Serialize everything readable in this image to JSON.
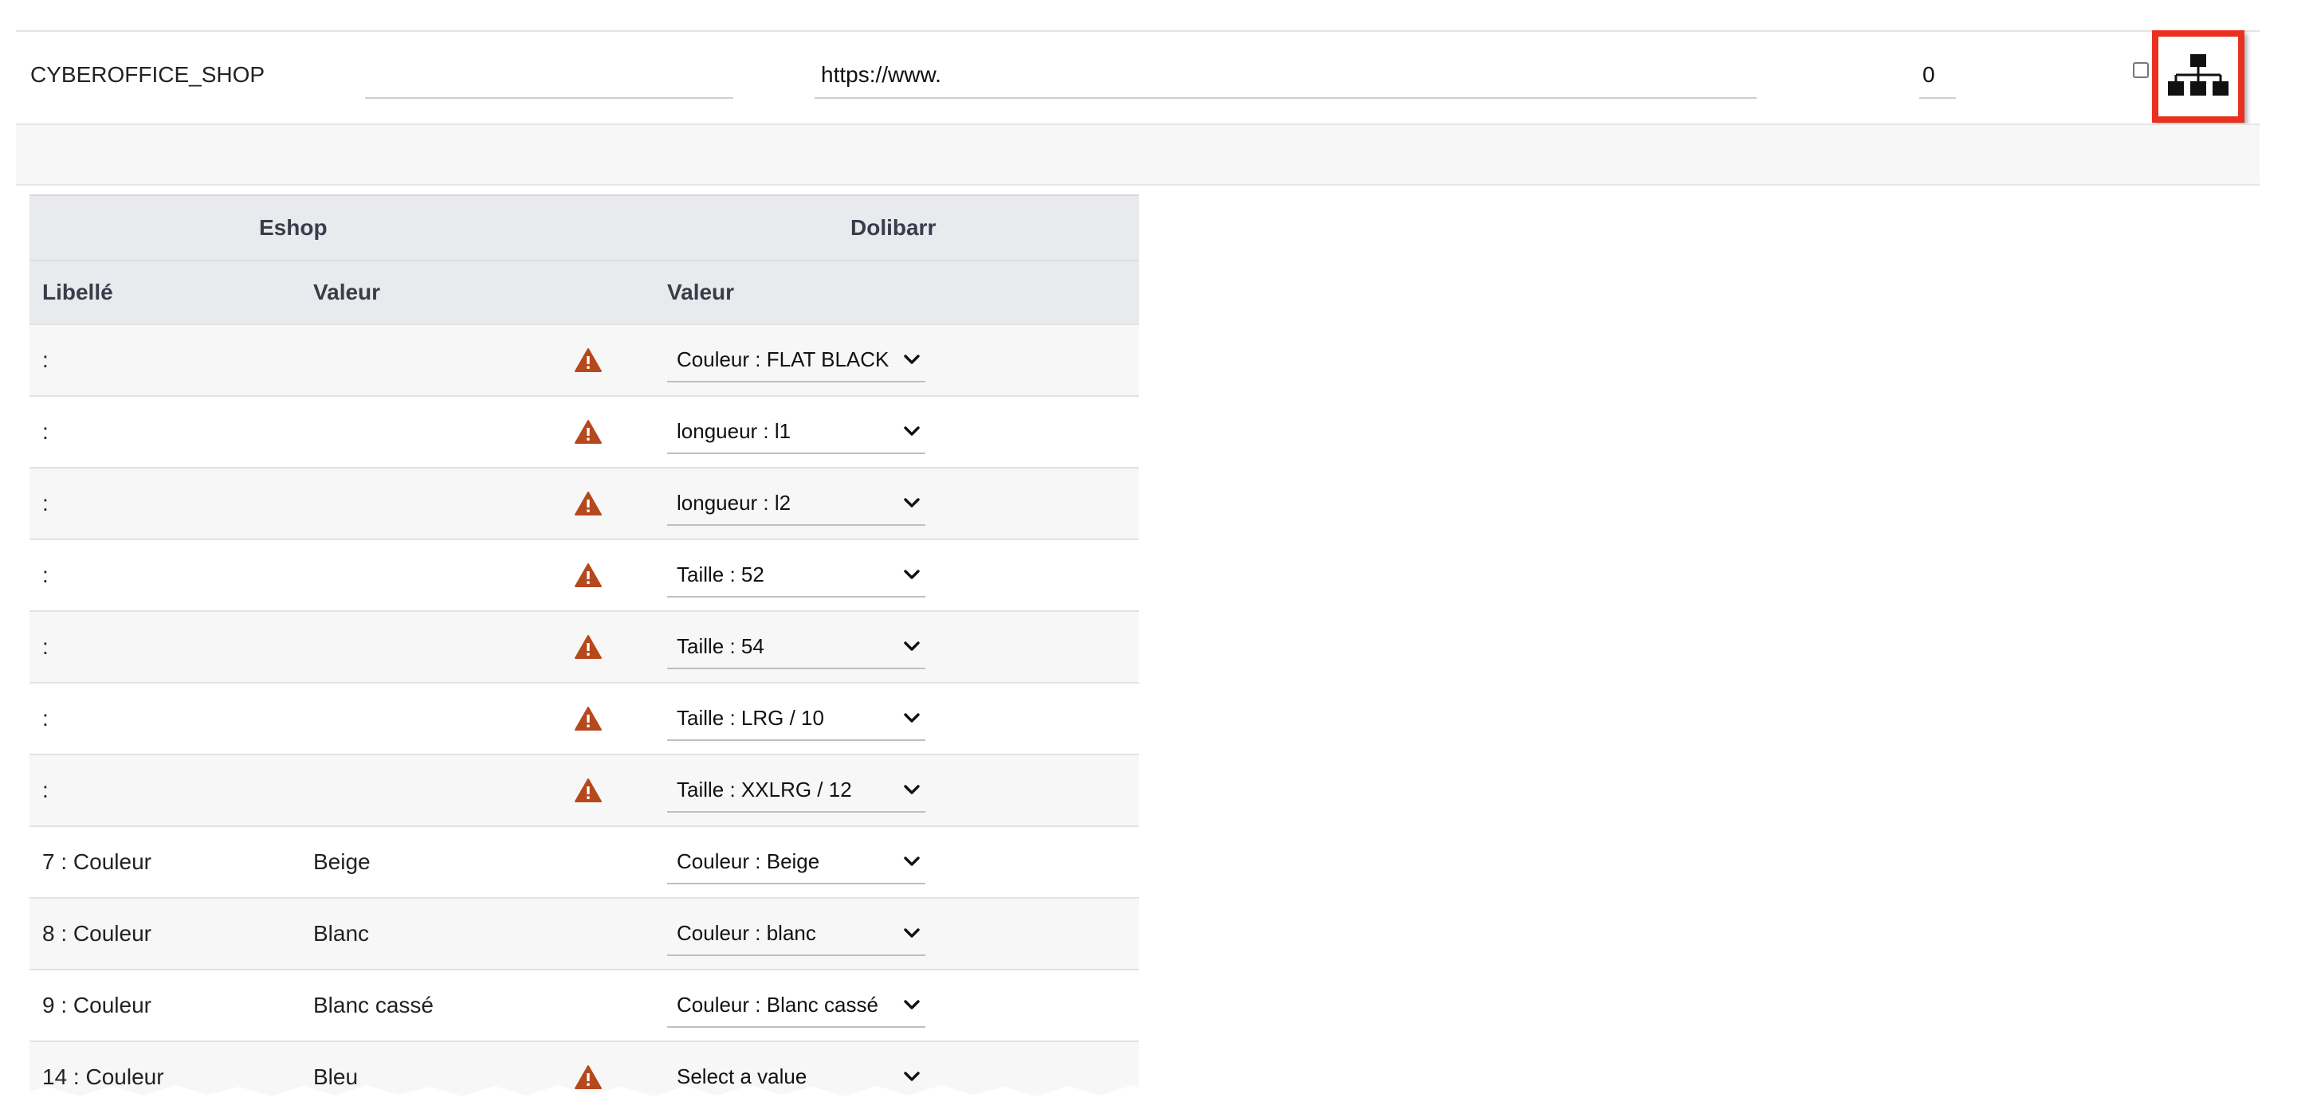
{
  "top": {
    "shop_name": "CYBEROFFICE_SHOP",
    "url": "https://www.",
    "count": "0"
  },
  "table": {
    "group_headers": [
      "Eshop",
      "Dolibarr"
    ],
    "column_headers": [
      "Libellé",
      "Valeur",
      "Valeur"
    ],
    "rows": [
      {
        "label": ":",
        "value": "",
        "warning": true,
        "select": "Couleur : FLAT BLACK"
      },
      {
        "label": ":",
        "value": "",
        "warning": true,
        "select": "longueur : l1"
      },
      {
        "label": ":",
        "value": "",
        "warning": true,
        "select": "longueur : l2"
      },
      {
        "label": ":",
        "value": "",
        "warning": true,
        "select": "Taille : 52"
      },
      {
        "label": ":",
        "value": "",
        "warning": true,
        "select": "Taille : 54"
      },
      {
        "label": ":",
        "value": "",
        "warning": true,
        "select": "Taille : LRG / 10"
      },
      {
        "label": ":",
        "value": "",
        "warning": true,
        "select": "Taille : XXLRG / 12"
      },
      {
        "label": "7 : Couleur",
        "value": "Beige",
        "warning": false,
        "select": "Couleur : Beige"
      },
      {
        "label": "8 : Couleur",
        "value": "Blanc",
        "warning": false,
        "select": "Couleur : blanc"
      },
      {
        "label": "9 : Couleur",
        "value": "Blanc cassé",
        "warning": false,
        "select": "Couleur : Blanc cassé"
      },
      {
        "label": "14 : Couleur",
        "value": "Bleu",
        "warning": true,
        "select": "Select a value"
      }
    ]
  },
  "colors": {
    "highlight": "#e8321f",
    "warning": "#b5481c",
    "header_bg": "#e9eaee"
  }
}
